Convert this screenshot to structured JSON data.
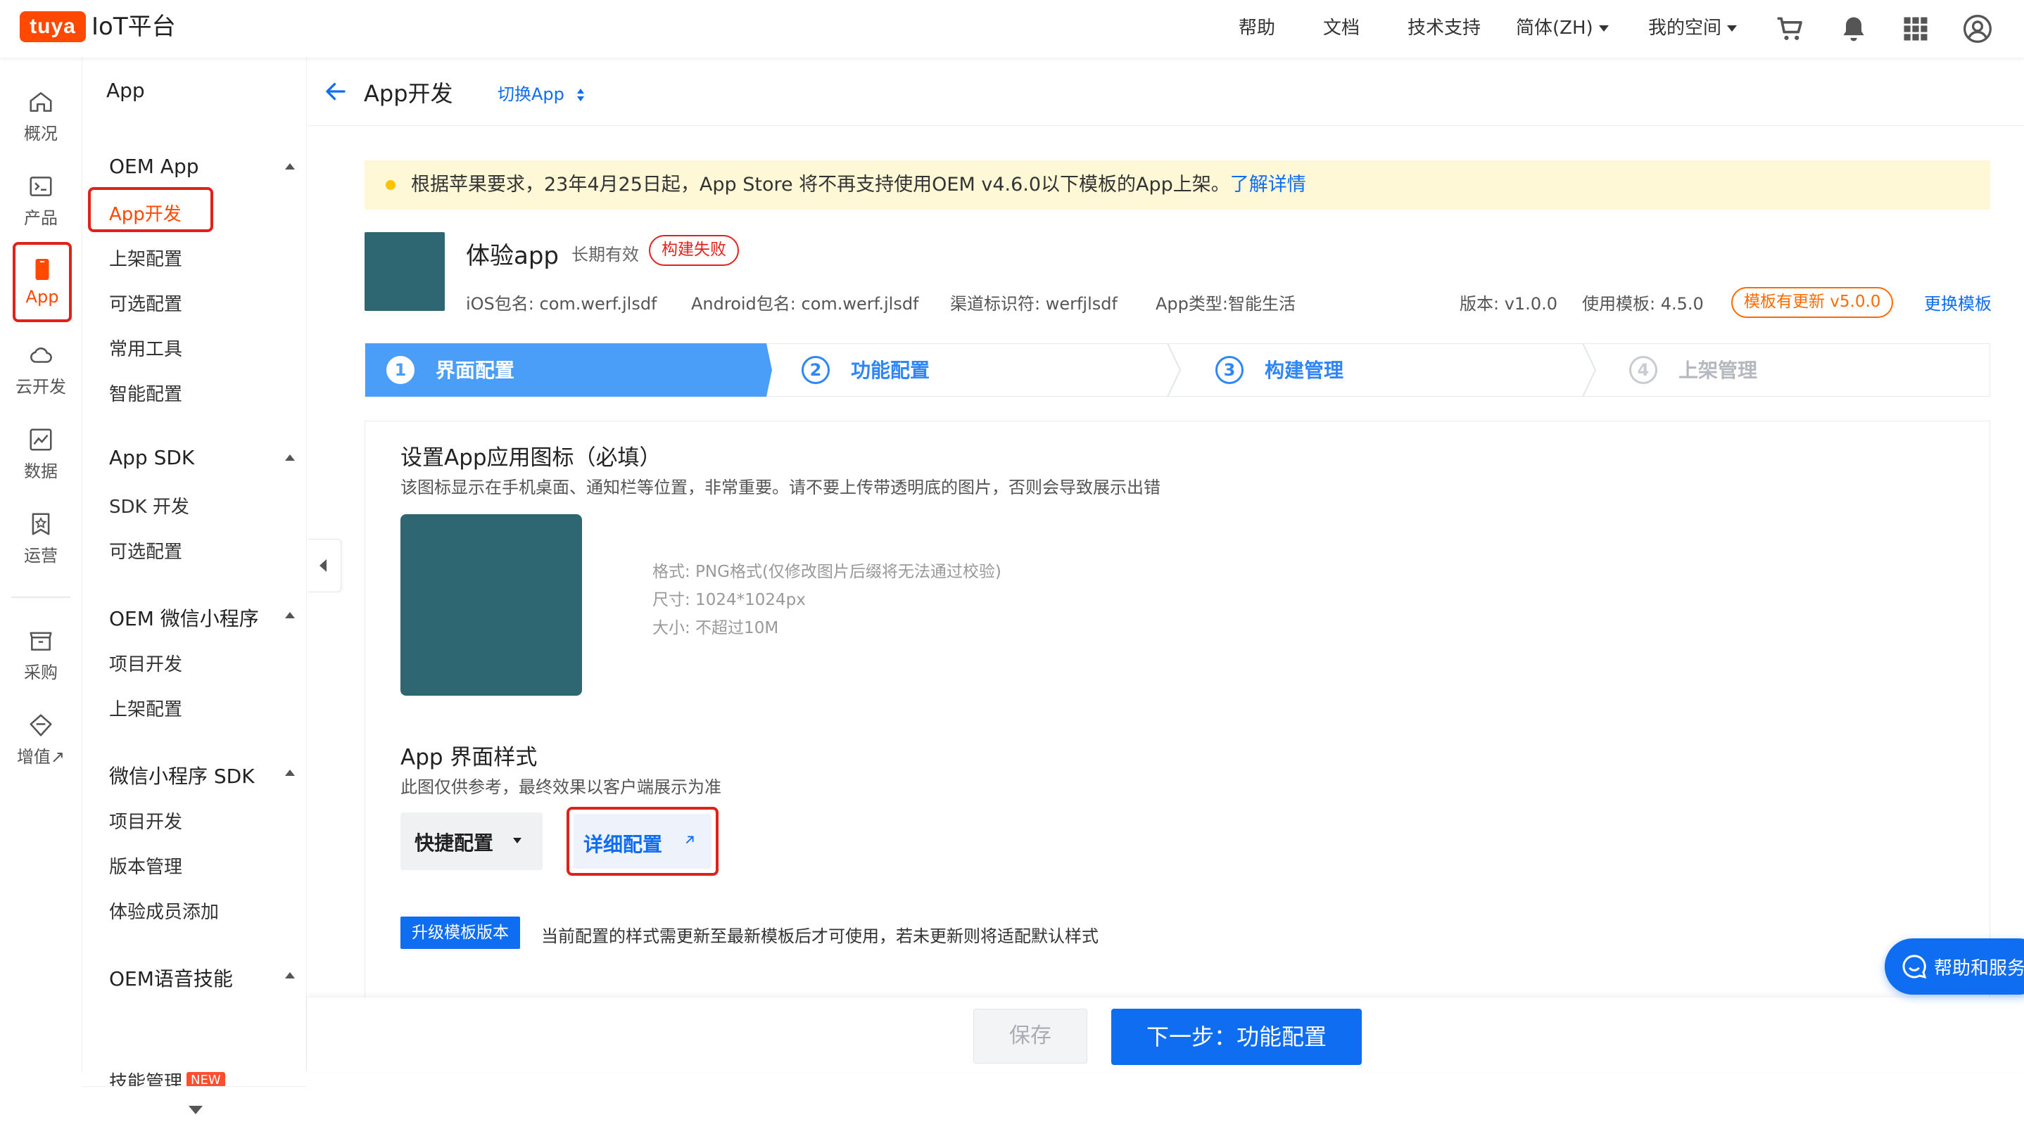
{
  "topbar": {
    "logo": "tuya",
    "app_name": "IoT平台",
    "nav": [
      "帮助",
      "文档",
      "技术支持"
    ],
    "language": "简体(ZH)",
    "workspace": "我的空间",
    "icons": [
      "cart-icon",
      "bell-icon",
      "apps-grid-icon",
      "user-avatar-icon"
    ]
  },
  "rail": {
    "items": [
      {
        "label": "概况",
        "icon": "home-icon"
      },
      {
        "label": "产品",
        "icon": "terminal-icon"
      },
      {
        "label": "App",
        "icon": "phone-icon",
        "active": true
      },
      {
        "label": "云开发",
        "icon": "cloud-icon"
      },
      {
        "label": "数据",
        "icon": "chart-icon"
      },
      {
        "label": "运营",
        "icon": "star-badge-icon"
      },
      {
        "label": "采购",
        "icon": "store-icon"
      },
      {
        "label": "增值↗",
        "icon": "diamond-icon"
      }
    ]
  },
  "sidebar": {
    "title": "App",
    "groups": [
      {
        "label": "OEM App",
        "items": [
          "App开发",
          "上架配置",
          "可选配置",
          "常用工具",
          "智能配置"
        ]
      },
      {
        "label": "App SDK",
        "items": [
          "SDK 开发",
          "可选配置"
        ]
      },
      {
        "label": "OEM 微信小程序",
        "items": [
          "项目开发",
          "上架配置"
        ]
      },
      {
        "label": "微信小程序 SDK",
        "items": [
          "项目开发",
          "版本管理",
          "体验成员添加"
        ]
      },
      {
        "label": "OEM语音技能",
        "items": [
          "技能管理"
        ]
      }
    ],
    "new_badge": "NEW"
  },
  "header": {
    "title": "App开发",
    "switch_app": "切换App"
  },
  "notice": {
    "text": "根据苹果要求，23年4月25日起，App Store 将不再支持使用OEM v4.6.0以下模板的App上架。",
    "link": "了解详情"
  },
  "app_info": {
    "name": "体验app",
    "validity": "长期有效",
    "status": "构建失败",
    "ios_package": "iOS包名: com.werf.jlsdf",
    "android_package": "Android包名: com.werf.jlsdf",
    "channel": "渠道标识符: werfjlsdf",
    "app_type": "App类型:智能生活",
    "version": "版本: v1.0.0",
    "template": "使用模板: 4.5.0",
    "template_update": "模板有更新 v5.0.0",
    "change_template": "更换模板",
    "icon_color": "#2e6671"
  },
  "steps": [
    {
      "num": "1",
      "label": "界面配置",
      "state": "active"
    },
    {
      "num": "2",
      "label": "功能配置",
      "state": "todo"
    },
    {
      "num": "3",
      "label": "构建管理",
      "state": "todo"
    },
    {
      "num": "4",
      "label": "上架管理",
      "state": "disabled"
    }
  ],
  "icon_section": {
    "title": "设置App应用图标（必填）",
    "desc": "该图标显示在手机桌面、通知栏等位置，非常重要。请不要上传带透明底的图片，否则会导致展示出错",
    "format": "格式: PNG格式(仅修改图片后缀将无法通过校验)",
    "size": "尺寸: 1024*1024px",
    "max": "大小: 不超过10M"
  },
  "style_section": {
    "title": "App 界面样式",
    "desc": "此图仅供参考，最终效果以客户端展示为准",
    "quick": "快捷配置",
    "detail": "详细配置",
    "upgrade_btn": "升级模板版本",
    "upgrade_text": "当前配置的样式需更新至最新模板后才可使用，若未更新则将适配默认样式"
  },
  "footer": {
    "save": "保存",
    "next": "下一步：功能配置"
  },
  "help_float": "帮助和服务",
  "colors": {
    "brand": "#ff4800",
    "primary": "#0f6df2",
    "active_step": "#4a9ef8",
    "red": "#e0231a",
    "notice_bg": "#fff8d6",
    "orange": "#ff6a00"
  }
}
